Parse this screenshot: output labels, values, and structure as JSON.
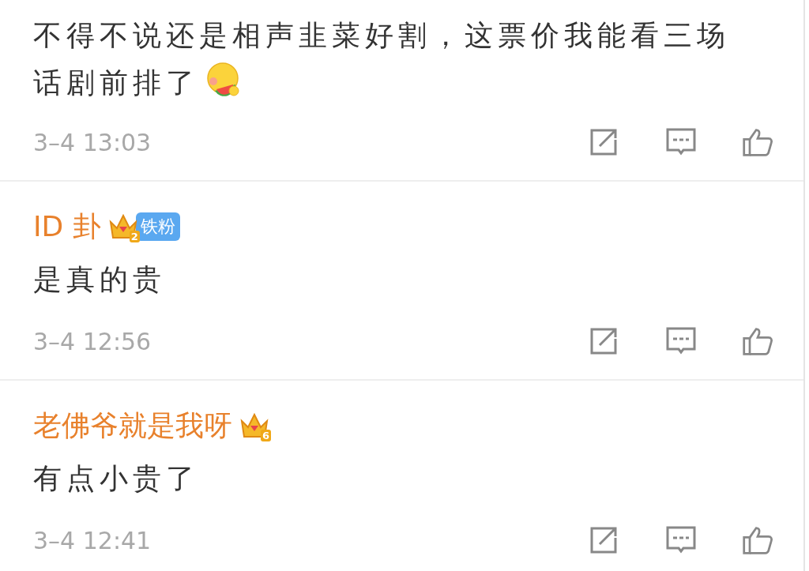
{
  "comments": [
    {
      "text": "不得不说还是相声韭菜好割，这票价我能看三场话剧前排了",
      "emoji": true,
      "time": "3–4 13:03"
    },
    {
      "user": {
        "name": "ID 卦",
        "badge_number": "2",
        "fan_badge": "铁粉"
      },
      "text": "是真的贵",
      "time": "3–4 12:56"
    },
    {
      "user": {
        "name": "老佛爷就是我呀",
        "badge_number": "6"
      },
      "text": "有点小贵了",
      "time": "3–4 12:41"
    }
  ]
}
